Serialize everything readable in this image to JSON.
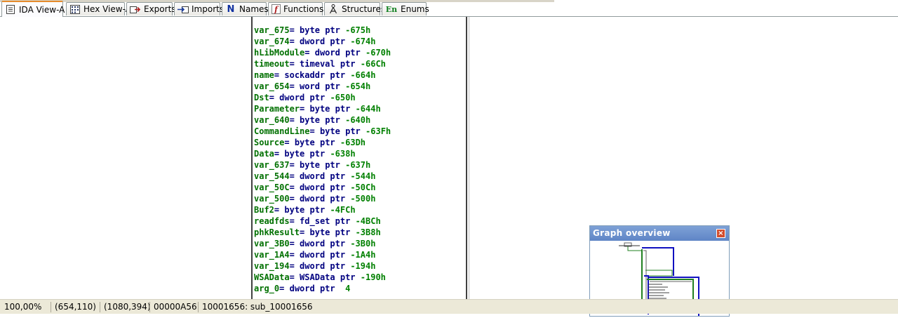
{
  "tabs": [
    {
      "label": "IDA View-A",
      "icon": "ida-view-icon",
      "active": true
    },
    {
      "label": "Hex View-A",
      "icon": "hex-view-icon",
      "active": false
    },
    {
      "label": "Exports",
      "icon": "exports-icon",
      "active": false
    },
    {
      "label": "Imports",
      "icon": "imports-icon",
      "active": false
    },
    {
      "label": "Names",
      "icon": "names-icon",
      "icon_glyph": "N",
      "active": false
    },
    {
      "label": "Functions",
      "icon": "functions-icon",
      "icon_glyph": "f",
      "active": false
    },
    {
      "label": "Structures",
      "icon": "structures-icon",
      "active": false
    },
    {
      "label": "Enums",
      "icon": "enums-icon",
      "icon_glyph": "En",
      "active": false
    }
  ],
  "listing": {
    "rows": [
      {
        "name": "var_675",
        "type": "byte",
        "offset": "-675h"
      },
      {
        "name": "var_674",
        "type": "dword",
        "offset": "-674h"
      },
      {
        "name": "hLibModule",
        "type": "dword",
        "offset": "-670h"
      },
      {
        "name": "timeout",
        "type": "timeval",
        "offset": "-66Ch"
      },
      {
        "name": "name",
        "type": "sockaddr",
        "offset": "-664h"
      },
      {
        "name": "var_654",
        "type": "word",
        "offset": "-654h"
      },
      {
        "name": "Dst",
        "type": "dword",
        "offset": "-650h"
      },
      {
        "name": "Parameter",
        "type": "byte",
        "offset": "-644h"
      },
      {
        "name": "var_640",
        "type": "byte",
        "offset": "-640h"
      },
      {
        "name": "CommandLine",
        "type": "byte",
        "offset": "-63Fh"
      },
      {
        "name": "Source",
        "type": "byte",
        "offset": "-63Dh"
      },
      {
        "name": "Data",
        "type": "byte",
        "offset": "-638h"
      },
      {
        "name": "var_637",
        "type": "byte",
        "offset": "-637h"
      },
      {
        "name": "var_544",
        "type": "dword",
        "offset": "-544h"
      },
      {
        "name": "var_50C",
        "type": "dword",
        "offset": "-50Ch"
      },
      {
        "name": "var_500",
        "type": "dword",
        "offset": "-500h"
      },
      {
        "name": "Buf2",
        "type": "byte",
        "offset": "-4FCh"
      },
      {
        "name": "readfds",
        "type": "fd_set",
        "offset": "-4BCh"
      },
      {
        "name": "phkResult",
        "type": "byte",
        "offset": "-3B8h"
      },
      {
        "name": "var_3B0",
        "type": "dword",
        "offset": "-3B0h"
      },
      {
        "name": "var_1A4",
        "type": "dword",
        "offset": "-1A4h"
      },
      {
        "name": "var_194",
        "type": "dword",
        "offset": "-194h"
      },
      {
        "name": "WSAData",
        "type": "WSAData",
        "offset": "-190h"
      },
      {
        "name": "arg_0",
        "type": "dword",
        "offset": " 4"
      }
    ],
    "equals": "=",
    "ptr": "ptr"
  },
  "graph_overview": {
    "title": "Graph overview",
    "close_glyph": "×"
  },
  "status": {
    "zoom": "100,00%",
    "mouse_pos": "(654,110)",
    "graph_pos": "(1080,394)",
    "file_offset": "00000A56",
    "location": "10001656: sub_10001656"
  },
  "colors": {
    "name": "#007000",
    "keyword": "#000080",
    "offset": "#008000",
    "active_tab_accent": "#e68b2c",
    "graph_title": "#6b8fcc"
  }
}
